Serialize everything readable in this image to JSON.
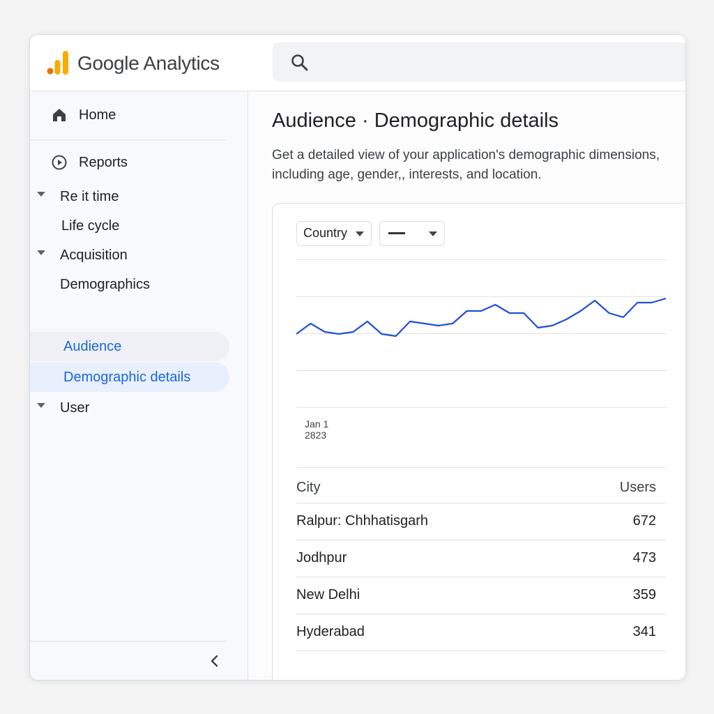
{
  "app": {
    "brand": "Google Analytics"
  },
  "colors": {
    "accent": "#1a66d8",
    "line": "#1f4fd8",
    "logo_orange": "#f9ab00",
    "logo_dark_orange": "#e37400"
  },
  "search": {
    "icon": "search-icon"
  },
  "sidebar": {
    "home": {
      "label": "Home",
      "icon": "home-icon"
    },
    "reports": {
      "label": "Reports",
      "icon": "play-circle-icon"
    },
    "groups": [
      {
        "label": "Re it time"
      },
      {
        "label": "Acquisition"
      },
      {
        "label": "User"
      }
    ],
    "life_cycle": "Life cycle",
    "demographics": "Demographics",
    "audience": "Audience",
    "demographic_details": "Demographic details",
    "collapse_icon": "chevron-left-icon"
  },
  "main": {
    "title": "Audience · Demographic details",
    "description": "Get a detailed view of your application's demographic dimensions, including age, gender,, interests, and location."
  },
  "controls": {
    "dimension": "Country",
    "chart_style_icon": "line-chart-style-icon"
  },
  "chart_data": {
    "type": "line",
    "x_first_label": [
      "Jan 1",
      "2823"
    ],
    "values": [
      51,
      56,
      52,
      51,
      52,
      57,
      51,
      50,
      57,
      56,
      55,
      56,
      62,
      62,
      65,
      61,
      61,
      54,
      55,
      58,
      62,
      67,
      61,
      59,
      66,
      66,
      68
    ],
    "grid": true
  },
  "table": {
    "headers": {
      "city": "City",
      "users": "Users"
    },
    "rows": [
      {
        "city": "Ralpur: Chhhatisgarh",
        "users": "672"
      },
      {
        "city": "Jodhpur",
        "users": "473"
      },
      {
        "city": "New Delhi",
        "users": "359"
      },
      {
        "city": "Hyderabad",
        "users": "341"
      }
    ]
  }
}
